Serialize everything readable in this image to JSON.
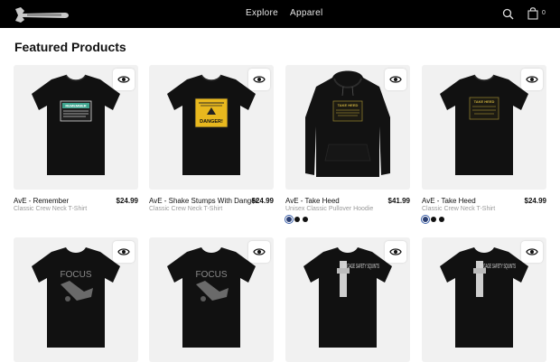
{
  "nav": {
    "items": [
      "Explore",
      "Apparel"
    ],
    "cart_count": "0"
  },
  "section": {
    "title": "Featured Products"
  },
  "colors": {
    "navy": "#2b3f73",
    "black": "#111111"
  },
  "products": [
    {
      "title": "AvE - Remember",
      "price": "$24.99",
      "subtitle": "Classic Crew Neck T-Shirt",
      "design": "REMEMBER",
      "swatches": []
    },
    {
      "title": "AvE - Shake Stumps With Danger",
      "price": "$24.99",
      "subtitle": "Classic Crew Neck T-Shirt",
      "design": "DANGER!",
      "swatches": []
    },
    {
      "title": "AvE - Take Heed",
      "price": "$41.99",
      "subtitle": "Unisex Classic Pullover Hoodie",
      "design": "TAKE HEED",
      "swatches": [
        "navy",
        "black",
        "black"
      ]
    },
    {
      "title": "AvE - Take Heed",
      "price": "$24.99",
      "subtitle": "Classic Crew Neck T-Shirt",
      "design": "TAKE HEED",
      "swatches": [
        "navy",
        "black",
        "black"
      ]
    },
    {
      "title": "",
      "price": "",
      "subtitle": "",
      "design": "FOCUS",
      "swatches": []
    },
    {
      "title": "",
      "price": "",
      "subtitle": "",
      "design": "FOCUS",
      "swatches": []
    },
    {
      "title": "",
      "price": "",
      "subtitle": "",
      "design": "ENGAGE SAFETY SQUINTS",
      "swatches": []
    },
    {
      "title": "",
      "price": "",
      "subtitle": "",
      "design": "ENGAGE SAFETY SQUINTS",
      "swatches": []
    }
  ]
}
